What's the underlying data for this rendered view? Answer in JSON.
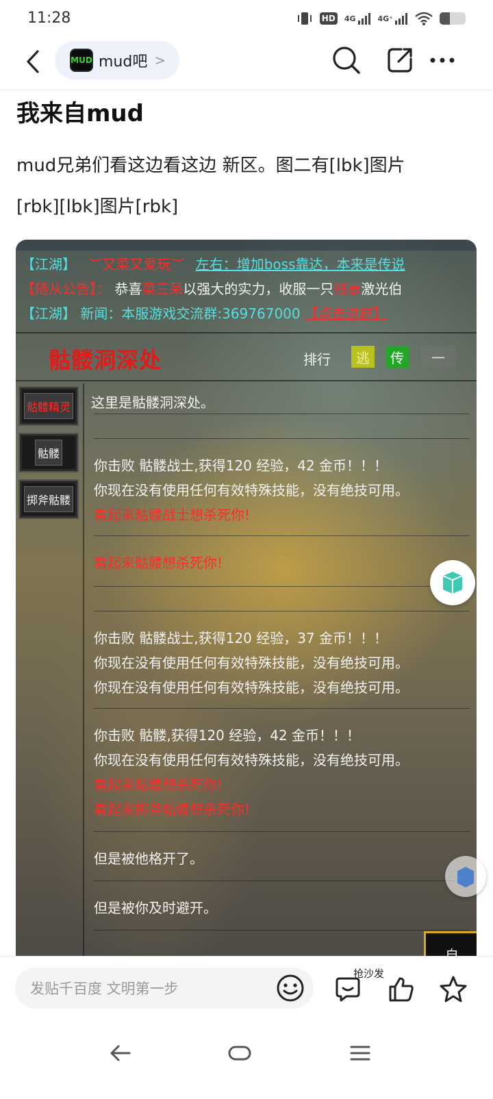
{
  "status_bar": {
    "time": "11:28",
    "network1": "4G",
    "network2": "4G⁺",
    "hd_label": "HD"
  },
  "nav": {
    "forum_logo_text": "MUD",
    "forum_name": "mud吧",
    "chevron": ">"
  },
  "post": {
    "title": "我来自mud",
    "body_line1": "mud兄弟们看这边看这边 新区。图二有[lbk]图片",
    "body_line2": "[rbk][lbk]图片[rbk]"
  },
  "game": {
    "broadcast": [
      {
        "tag": "【江湖】",
        "prefix": "",
        "highlight": "︶又菜又爱玩︶",
        "text": "左右：增加boss靠达，本来是传说"
      },
      {
        "tag": "【随从公告】：",
        "prefix": "恭喜",
        "highlight": "菜三呆",
        "text": "以强大的实力，收服一只",
        "tail": "残暴",
        "tail2": "激光伯"
      },
      {
        "tag": "【江湖】",
        "text": "新闻：本服游戏交流群:369767000",
        "link": "【点击进群】"
      }
    ],
    "location_title": "骷髅洞深处",
    "rank_label": "排行",
    "flee_label": "逃",
    "tele_label": "传",
    "dash_label": "一",
    "npcs": [
      "骷髅精灵",
      "骷髅",
      "掷斧骷髅"
    ],
    "room_desc": "这里是骷髅洞深处。",
    "log": {
      "block1_line1": "你击败 骷髅战士,获得120 经验，42 金币！！！",
      "block1_line2": "你现在没有使用任何有效特殊技能，没有绝技可用。",
      "block1_line3": "看起来骷髅战士想杀死你!",
      "block2_line1": "看起来骷髅想杀死你!",
      "block3_line1": "你击败 骷髅战士,获得120 经验，37 金币！！！",
      "block3_line2": "你现在没有使用任何有效特殊技能，没有绝技可用。",
      "block3_line3": "你现在没有使用任何有效特殊技能，没有绝技可用。",
      "block4_line1": "你击败 骷髅,获得120 经验，42 金币！！！",
      "block4_line2": "你现在没有使用任何有效特殊技能，没有绝技可用。",
      "block4_line3": "看起来骷髅想杀死你!",
      "block4_line4": "看起来掷斧骷髅想杀死你!",
      "block5_line1": "但是被他格开了。",
      "block6_line1": "但是被你及时避开。"
    },
    "corner_label": "自"
  },
  "reply_bar": {
    "placeholder": "发贴千百度 文明第一步",
    "sofa_label": "抢沙发"
  },
  "colors": {
    "accent_red": "#e21a1a",
    "game_cyan": "#54e0e0",
    "chip_bg": "#eef2fb"
  }
}
